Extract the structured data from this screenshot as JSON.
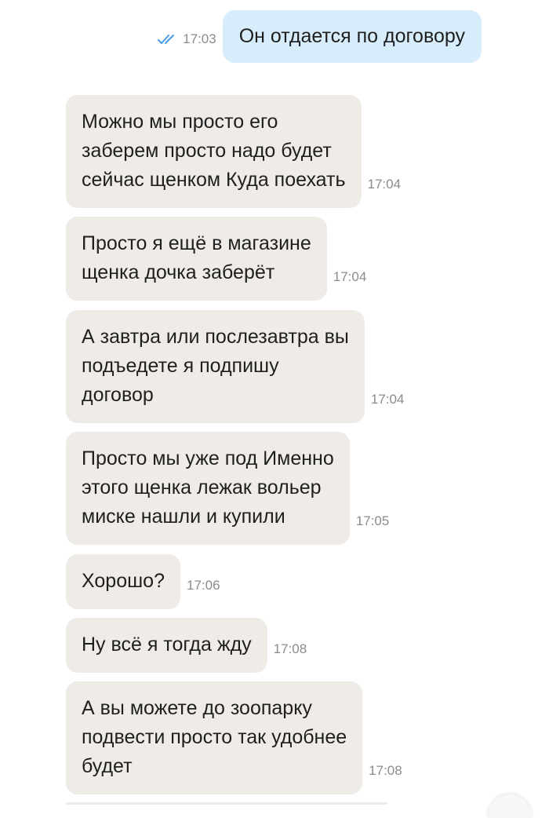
{
  "messages": [
    {
      "direction": "outgoing",
      "text": "Он отдается по договору",
      "time": "17:03",
      "status": "read"
    },
    {
      "direction": "incoming",
      "text": "Можно мы просто его\nзаберем просто надо будет\nсейчас щенком Куда поехать",
      "time": "17:04"
    },
    {
      "direction": "incoming",
      "text": "Просто я ещё в магазине\nщенка дочка заберёт",
      "time": "17:04"
    },
    {
      "direction": "incoming",
      "text": "А завтра или послезавтра вы\nподъедете я подпишу\nдоговор",
      "time": "17:04"
    },
    {
      "direction": "incoming",
      "text": "Просто мы уже под Именно\nэтого щенка лежак вольер\nмиске нашли и купили",
      "time": "17:05"
    },
    {
      "direction": "incoming",
      "text": "Хорошо?",
      "time": "17:06"
    },
    {
      "direction": "incoming",
      "text": "Ну всё я тогда жду",
      "time": "17:08"
    },
    {
      "direction": "incoming",
      "text": "А вы можете до зоопарку\nподвести просто так удобнее\nбудет",
      "time": "17:08"
    }
  ],
  "icons": {
    "read_status": "double-check-icon"
  },
  "colors": {
    "incoming_bubble": "#efece8",
    "outgoing_bubble": "#d7edfb",
    "timestamp": "#8b8b8b",
    "read_check": "#4a9be8",
    "text": "#1f1f1f"
  }
}
